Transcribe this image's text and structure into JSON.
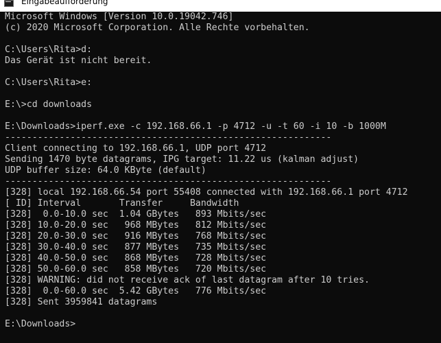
{
  "window": {
    "title": "Eingabeaufforderung",
    "icon": "console-icon"
  },
  "colors": {
    "console_background": "#0c0c0c",
    "console_text": "#cccccc",
    "titlebar_background": "#ffffff"
  },
  "console": {
    "lines": [
      "Microsoft Windows [Version 10.0.19042.746]",
      "(c) 2020 Microsoft Corporation. Alle Rechte vorbehalten.",
      "",
      "C:\\Users\\Rita>d:",
      "Das Gerät ist nicht bereit.",
      "",
      "C:\\Users\\Rita>e:",
      "",
      "E:\\>cd downloads",
      "",
      "E:\\Downloads>iperf.exe -c 192.168.66.1 -p 4712 -u -t 60 -i 10 -b 1000M",
      "------------------------------------------------------------",
      "Client connecting to 192.168.66.1, UDP port 4712",
      "Sending 1470 byte datagrams, IPG target: 11.22 us (kalman adjust)",
      "UDP buffer size: 64.0 KByte (default)",
      "------------------------------------------------------------",
      "[328] local 192.168.66.54 port 55408 connected with 192.168.66.1 port 4712",
      "[ ID] Interval       Transfer     Bandwidth",
      "[328]  0.0-10.0 sec  1.04 GBytes   893 Mbits/sec",
      "[328] 10.0-20.0 sec   968 MBytes   812 Mbits/sec",
      "[328] 20.0-30.0 sec   916 MBytes   768 Mbits/sec",
      "[328] 30.0-40.0 sec   877 MBytes   735 Mbits/sec",
      "[328] 40.0-50.0 sec   868 MBytes   728 Mbits/sec",
      "[328] 50.0-60.0 sec   858 MBytes   720 Mbits/sec",
      "[328] WARNING: did not receive ack of last datagram after 10 tries.",
      "[328]  0.0-60.0 sec  5.42 GBytes   776 Mbits/sec",
      "[328] Sent 3959841 datagrams",
      "",
      "E:\\Downloads>"
    ]
  }
}
